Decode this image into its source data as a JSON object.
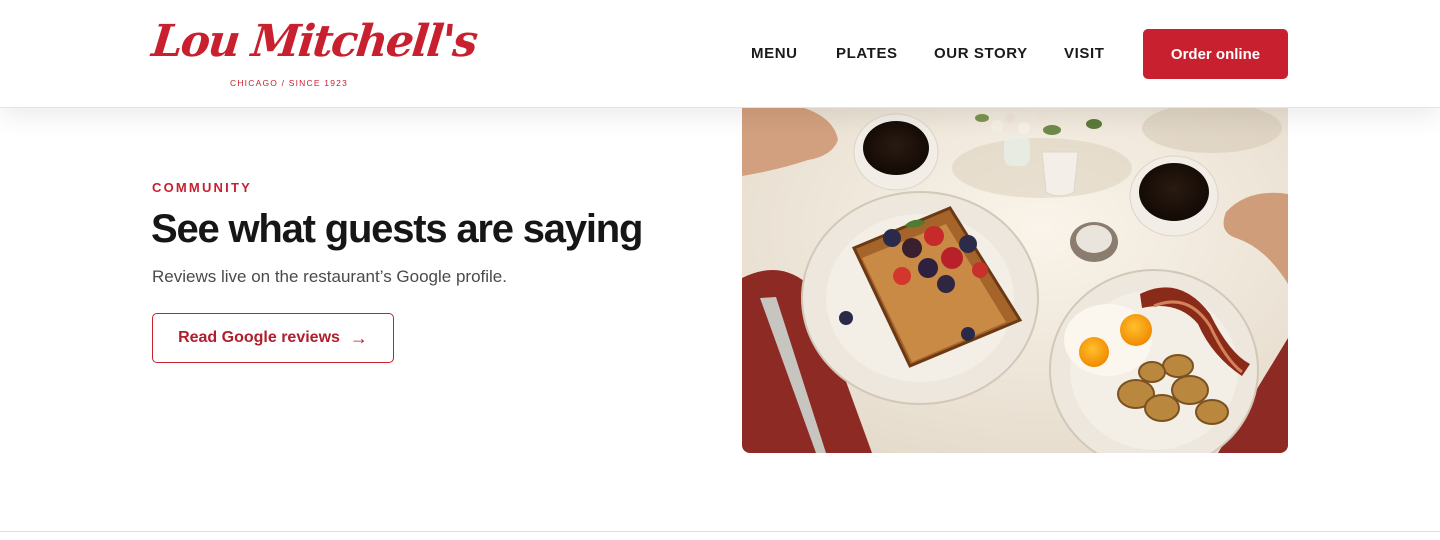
{
  "brand": {
    "name": "Lou Mitchell's",
    "tagline": "CHICAGO / SINCE 1923",
    "accent_color": "#c8202f"
  },
  "nav": {
    "items": [
      {
        "label": "MENU"
      },
      {
        "label": "PLATES"
      },
      {
        "label": "OUR STORY"
      },
      {
        "label": "VISIT"
      }
    ],
    "cta_label": "Order online"
  },
  "community": {
    "eyebrow": "COMMUNITY",
    "heading": "See what guests are saying",
    "subtext": "Reviews live on the restaurant’s Google profile.",
    "button_label": "Read Google reviews",
    "button_icon": "arrow-right-icon",
    "arrow_glyph": "→"
  },
  "hero_image": {
    "subject": "breakfast-table-photo"
  }
}
